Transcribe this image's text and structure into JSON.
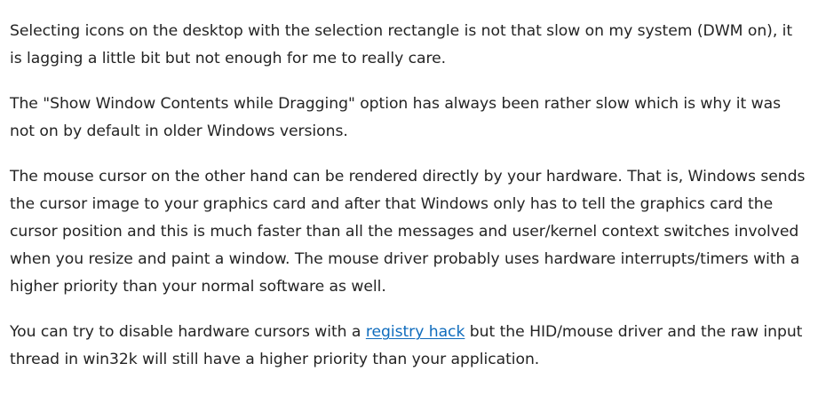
{
  "post": {
    "paragraph_1": "Selecting icons on the desktop with the selection rectangle is not that slow on my system (DWM on), it is lagging a little bit but not enough for me to really care.",
    "paragraph_2": "The \"Show Window Contents while Dragging\" option has always been rather slow which is why it was not on by default in older Windows versions.",
    "paragraph_3": "The mouse cursor on the other hand can be rendered directly by your hardware. That is, Windows sends the cursor image to your graphics card and after that Windows only has to tell the graphics card the cursor position and this is much faster than all the messages and user/kernel context switches involved when you resize and paint a window. The mouse driver probably uses hardware interrupts/timers with a higher priority than your normal software as well.",
    "paragraph_4": {
      "before_link": "You can try to disable hardware cursors with a ",
      "link_text": "registry hack",
      "after_link": " but the HID/mouse driver and the raw input thread in win32k will still have a higher priority than your application."
    }
  },
  "colors": {
    "text": "#242424",
    "link": "#0f6cbd",
    "background": "#ffffff"
  }
}
